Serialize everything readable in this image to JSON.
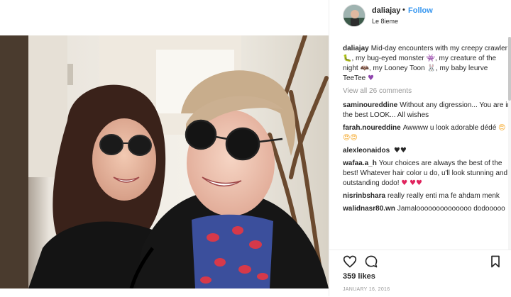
{
  "post": {
    "username": "daliajay",
    "separator": "•",
    "follow_label": "Follow",
    "location": "Le 8ieme"
  },
  "caption": {
    "username": "daliajay",
    "text_1": "Mid-day encounters with my creepy crawler",
    "text_2": ", my bug-eyed monster",
    "text_3": ", my creature of the night",
    "text_4": ", my Looney Toon",
    "text_5": ", my baby leurve TeeTee"
  },
  "view_all_label": "View all 26 comments",
  "comments": [
    {
      "username": "saminoureddine",
      "text": "Without any digression... You are in the best LOOK... All wishes"
    },
    {
      "username": "farah.noureddine",
      "text": "Awwww u look adorable dédé"
    },
    {
      "username": "alexleonaidos",
      "text": ""
    },
    {
      "username": "wafaa.a_h",
      "text": "Your choices are always the best of the best! Whatever hair color u do, u'll look stunning and outstanding dodo!"
    },
    {
      "username": "nisrinbshara",
      "text": "really really enti ma fe ahdam menk"
    },
    {
      "username": "walidnasr80.wn",
      "text": "Jamaloooooooooooooo dodooooo"
    }
  ],
  "emoji": {
    "caterpillar": "🐛",
    "monster": "👾",
    "night": "🦇",
    "toon": "🐰",
    "heart_purple": "♥",
    "heart_eyes": "😍😍😍",
    "hearts_black": "♥♥",
    "heart_red": "♥",
    "hearts_red": "♥♥"
  },
  "likes_label": "359 likes",
  "date_label": "JANUARY 16, 2016",
  "colors": {
    "link": "#3897f0",
    "text": "#262626",
    "muted": "#999999"
  }
}
